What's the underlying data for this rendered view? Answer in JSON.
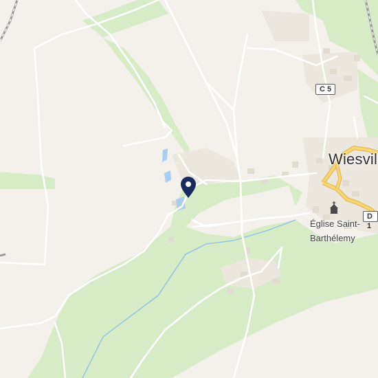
{
  "map": {
    "place_label": "Wiesville",
    "poi": {
      "line1": "Église Saint-",
      "line2": "Barthélemy",
      "icon": "church-icon"
    },
    "road_shields": [
      "C 5",
      "D 1"
    ],
    "marker": {
      "icon": "location-pin-icon",
      "color": "#1b2a5e"
    },
    "colors": {
      "land": "#f4f1ec",
      "forest": "#d6ebc6",
      "water": "#a8cdee",
      "stream": "#8ebfe9",
      "road": "#ffffff",
      "major_road": "#f8c85a",
      "building": "#ece6dd",
      "railway": "#9a9a9a"
    }
  }
}
